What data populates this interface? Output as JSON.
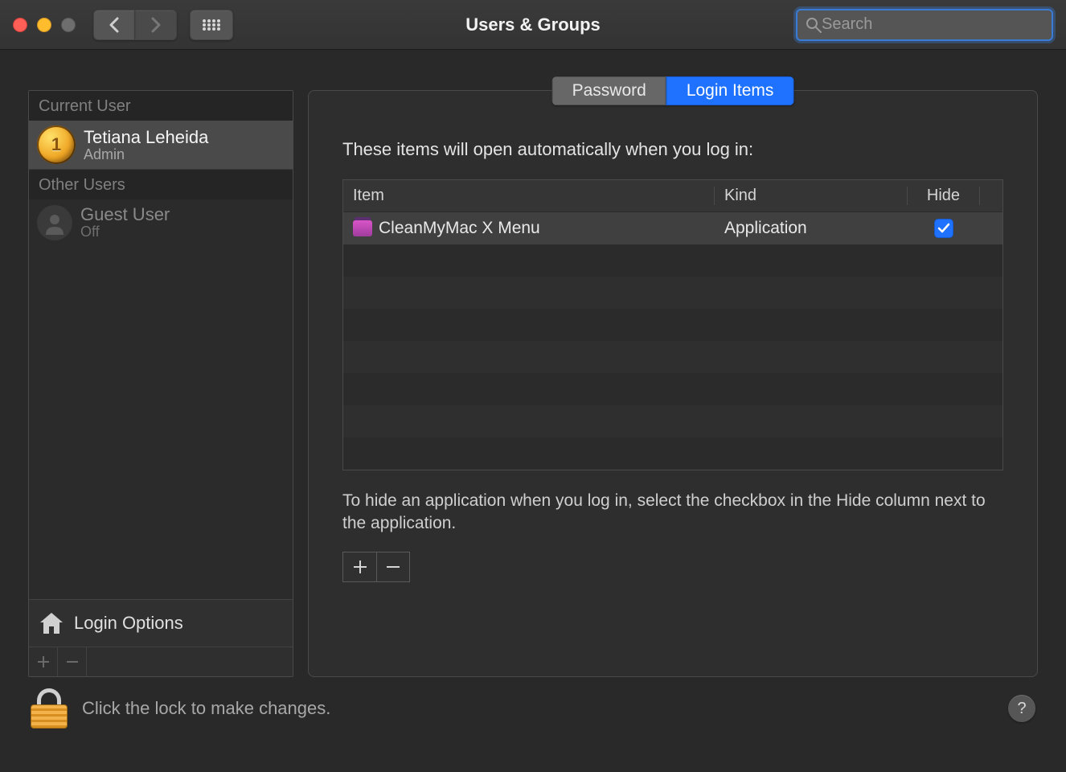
{
  "window": {
    "title": "Users & Groups",
    "search_placeholder": "Search"
  },
  "sidebar": {
    "current_user_header": "Current User",
    "other_users_header": "Other Users",
    "current_user": {
      "name": "Tetiana Leheida",
      "role": "Admin"
    },
    "other_users": [
      {
        "name": "Guest User",
        "role": "Off"
      }
    ],
    "login_options_label": "Login Options"
  },
  "tabs": {
    "password": "Password",
    "login_items": "Login Items",
    "active": "login_items"
  },
  "login_items": {
    "lead": "These items will open automatically when you log in:",
    "columns": {
      "item": "Item",
      "kind": "Kind",
      "hide": "Hide"
    },
    "rows": [
      {
        "name": "CleanMyMac X Menu",
        "kind": "Application",
        "hide": true
      }
    ],
    "hint": "To hide an application when you log in, select the checkbox in the Hide column next to the application."
  },
  "footer": {
    "lock_text": "Click the lock to make changes.",
    "help_label": "?"
  }
}
